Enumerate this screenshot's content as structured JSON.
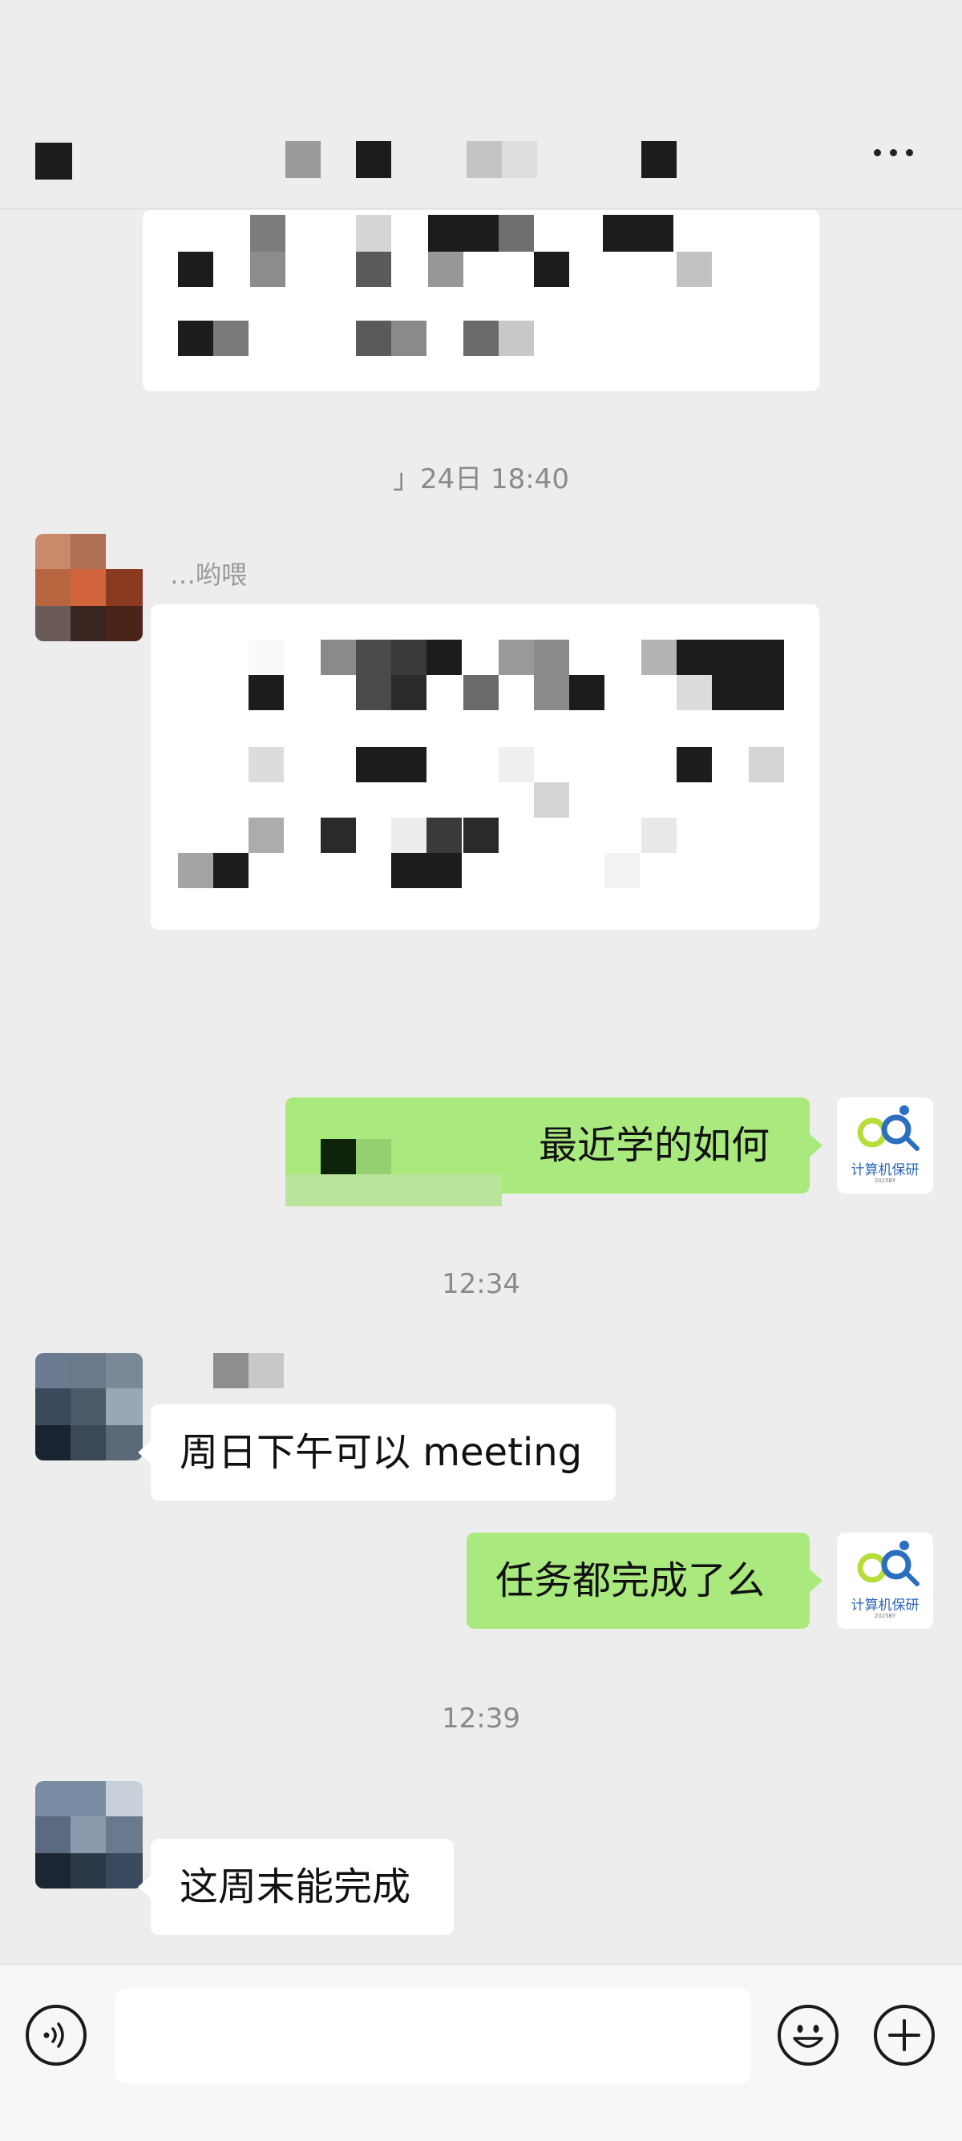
{
  "header": {
    "back_icon": "back-arrow-icon",
    "title": "",
    "more_icon": "more-dots-icon"
  },
  "messages": {
    "timestamp_1": "」24日 18:40",
    "sender_partial_1": "…哟喂",
    "outgoing_1": "最近学的如何",
    "timestamp_2": "12:34",
    "incoming_2": "周日下午可以 meeting",
    "outgoing_2": "任务都完成了么",
    "timestamp_3": "12:39",
    "incoming_3": "这周末能完成"
  },
  "self_avatar": {
    "logo_text": "计算机保研",
    "logo_year": "2025BY"
  },
  "input_bar": {
    "voice_icon": "voice-icon",
    "text_value": "",
    "emoji_icon": "emoji-icon",
    "plus_icon": "plus-icon"
  },
  "colors": {
    "background": "#ededed",
    "incoming_bubble": "#ffffff",
    "outgoing_bubble": "#a9e97e",
    "timestamp": "#8a8a8a"
  }
}
